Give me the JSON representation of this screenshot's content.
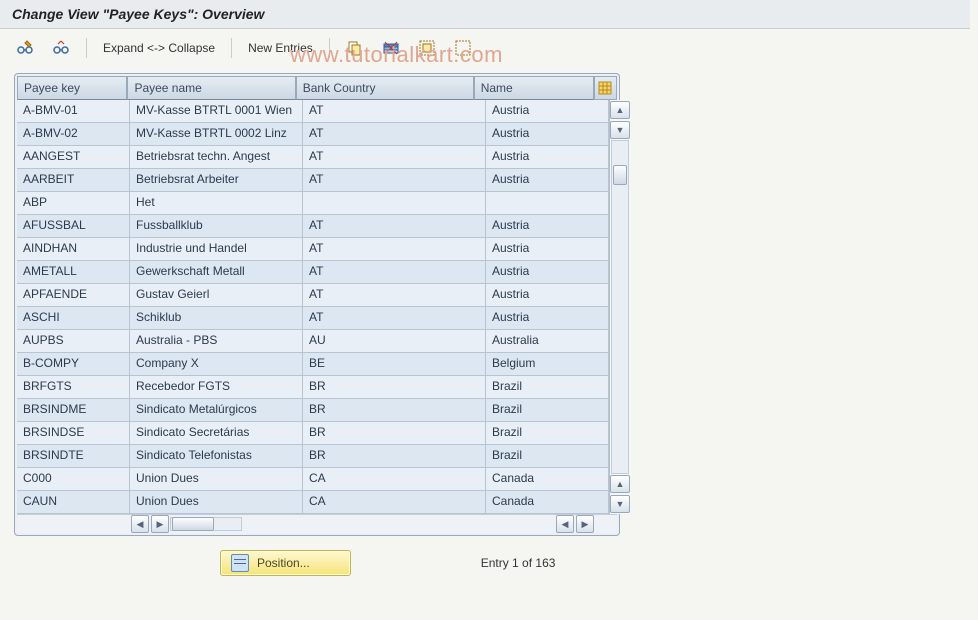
{
  "title": "Change View \"Payee Keys\": Overview",
  "watermark": "www.tutorialkart.com",
  "toolbar": {
    "expand_collapse": "Expand <-> Collapse",
    "new_entries": "New Entries"
  },
  "columns": {
    "key": "Payee key",
    "name": "Payee name",
    "bank_country": "Bank Country",
    "country_name": "Name"
  },
  "rows": [
    {
      "key": "A-BMV-01",
      "name": "MV-Kasse  BTRTL 0001 Wien",
      "bc": "AT",
      "cn": "Austria"
    },
    {
      "key": "A-BMV-02",
      "name": "MV-Kasse  BTRTL 0002 Linz",
      "bc": "AT",
      "cn": "Austria"
    },
    {
      "key": "AANGEST",
      "name": "Betriebsrat techn. Angest",
      "bc": "AT",
      "cn": "Austria"
    },
    {
      "key": "AARBEIT",
      "name": "Betriebsrat Arbeiter",
      "bc": "AT",
      "cn": "Austria"
    },
    {
      "key": "ABP",
      "name": "Het",
      "bc": "",
      "cn": ""
    },
    {
      "key": "AFUSSBAL",
      "name": "Fussballklub",
      "bc": "AT",
      "cn": "Austria"
    },
    {
      "key": "AINDHAN",
      "name": "Industrie und Handel",
      "bc": "AT",
      "cn": "Austria"
    },
    {
      "key": "AMETALL",
      "name": "Gewerkschaft Metall",
      "bc": "AT",
      "cn": "Austria"
    },
    {
      "key": "APFAENDE",
      "name": "Gustav Geierl",
      "bc": "AT",
      "cn": "Austria"
    },
    {
      "key": "ASCHI",
      "name": "Schiklub",
      "bc": "AT",
      "cn": "Austria"
    },
    {
      "key": "AUPBS",
      "name": "Australia - PBS",
      "bc": "AU",
      "cn": "Australia"
    },
    {
      "key": "B-COMPY",
      "name": "Company X",
      "bc": "BE",
      "cn": "Belgium"
    },
    {
      "key": "BRFGTS",
      "name": "Recebedor FGTS",
      "bc": "BR",
      "cn": "Brazil"
    },
    {
      "key": "BRSINDME",
      "name": "Sindicato Metalúrgicos",
      "bc": "BR",
      "cn": "Brazil"
    },
    {
      "key": "BRSINDSE",
      "name": "Sindicato Secretárias",
      "bc": "BR",
      "cn": "Brazil"
    },
    {
      "key": "BRSINDTE",
      "name": "Sindicato Telefonistas",
      "bc": "BR",
      "cn": "Brazil"
    },
    {
      "key": "C000",
      "name": "Union Dues",
      "bc": "CA",
      "cn": "Canada"
    },
    {
      "key": "CAUN",
      "name": "Union Dues",
      "bc": "CA",
      "cn": "Canada"
    }
  ],
  "footer": {
    "position_label": "Position...",
    "entry_text": "Entry 1 of 163"
  }
}
